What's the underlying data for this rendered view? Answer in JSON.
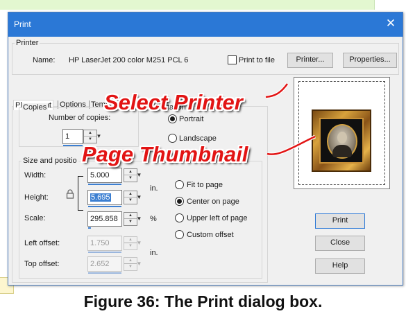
{
  "window": {
    "title": "Print",
    "close_glyph": "✕"
  },
  "printer": {
    "group_label": "Printer",
    "name_label": "Name:",
    "name_value": "HP LaserJet 200 color M251 PCL 6",
    "print_to_file_label": "Print to file",
    "print_to_file_checked": false,
    "printer_button": "Printer...",
    "properties_button": "Properties..."
  },
  "tabs": [
    {
      "label": "Placement",
      "active": true
    },
    {
      "label": "Options",
      "active": false
    },
    {
      "label": "Templ",
      "active": false
    }
  ],
  "copies": {
    "group_label": "Copies",
    "number_label": "Number of copies:",
    "value": "1"
  },
  "orientation": {
    "group_label": "Orientation",
    "options": [
      {
        "label": "Portrait",
        "selected": true
      },
      {
        "label": "Landscape",
        "selected": false
      }
    ]
  },
  "size_position": {
    "group_label": "Size and positio",
    "width_label": "Width:",
    "width_value": "5.000",
    "height_label": "Height:",
    "height_value": "5.695",
    "scale_label": "Scale:",
    "scale_value": "295.858",
    "unit_in": "in.",
    "unit_percent": "%",
    "lock_icon": "lock-icon",
    "left_offset_label": "Left offset:",
    "left_offset_value": "1.750",
    "top_offset_label": "Top offset:",
    "top_offset_value": "2.652",
    "offset_unit": "in.",
    "placement_options": [
      {
        "label": "Fit to page",
        "selected": false
      },
      {
        "label": "Center on page",
        "selected": true
      },
      {
        "label": "Upper left of page",
        "selected": false
      },
      {
        "label": "Custom offset",
        "selected": false
      }
    ]
  },
  "buttons": {
    "print": "Print",
    "close": "Close",
    "help": "Help"
  },
  "annotations": {
    "select_printer": "Select Printer",
    "page_thumbnail": "Page Thumbnail"
  },
  "caption": "Figure 36: The Print dialog box.",
  "colors": {
    "titlebar": "#2b78d6",
    "annotation": "#e21414",
    "selection": "#3c7fd1"
  }
}
